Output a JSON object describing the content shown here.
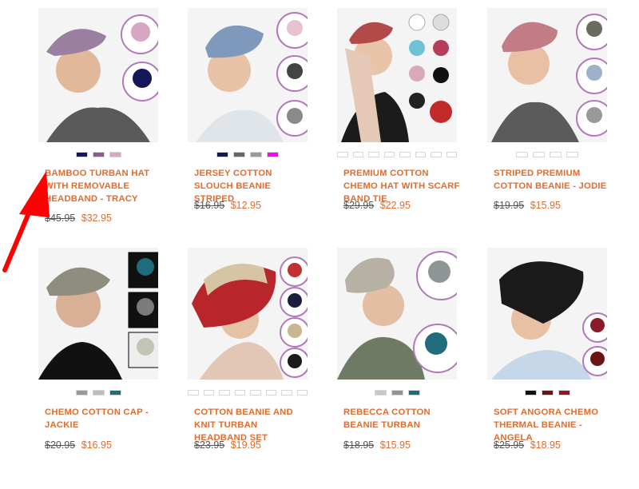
{
  "products": [
    {
      "title": "BAMBOO TURBAN HAT WITH REMOVABLE HEADBAND - TRACY",
      "old_price": "$45.95",
      "new_price": "$32.95",
      "swatches": [
        "#16165a",
        "#8a5a95",
        "#d6a6c2"
      ]
    },
    {
      "title": "JERSEY COTTON SLOUCH BEANIE STRIPED",
      "old_price": "$16.95",
      "new_price": "$12.95",
      "swatches": [
        "#131a4d",
        "#666666",
        "#9a9a9a",
        "#ff00ff"
      ]
    },
    {
      "title": "PREMIUM COTTON CHEMO HAT WITH SCARF BAND TIE",
      "old_price": "$29.95",
      "new_price": "$22.95",
      "swatches": [
        "#ffffff",
        "#ffffff",
        "#ffffff",
        "#ffffff",
        "#ffffff",
        "#ffffff",
        "#ffffff",
        "#ffffff"
      ]
    },
    {
      "title": "STRIPED PREMIUM COTTON BEANIE - JODIE",
      "old_price": "$19.95",
      "new_price": "$15.95",
      "swatches": [
        "#ffffff",
        "#ffffff",
        "#ffffff",
        "#ffffff"
      ]
    },
    {
      "title": "CHEMO COTTON CAP - JACKIE",
      "old_price": "$20.95",
      "new_price": "$16.95",
      "swatches": [
        "#999999",
        "#c3b9c0",
        "#1f6d7c"
      ]
    },
    {
      "title": "COTTON BEANIE AND KNIT TURBAN HEADBAND SET",
      "old_price": "$23.95",
      "new_price": "$19.95",
      "swatches": [
        "#ffffff",
        "#ffffff",
        "#ffffff",
        "#ffffff",
        "#ffffff",
        "#ffffff",
        "#ffffff",
        "#ffffff"
      ]
    },
    {
      "title": "REBECCA COTTON BEANIE TURBAN",
      "old_price": "$18.95",
      "new_price": "$15.95",
      "swatches": [
        "#c7c7c7",
        "#8f9495",
        "#1f6d7c"
      ]
    },
    {
      "title": "SOFT ANGORA CHEMO THERMAL BEANIE - ANGELA",
      "old_price": "$25.95",
      "new_price": "$18.95",
      "swatches": [
        "#111111",
        "#6a1414",
        "#8b1a2a"
      ]
    }
  ],
  "colors": {
    "accent": "#e16c2e",
    "arrow": "#ff0000"
  }
}
